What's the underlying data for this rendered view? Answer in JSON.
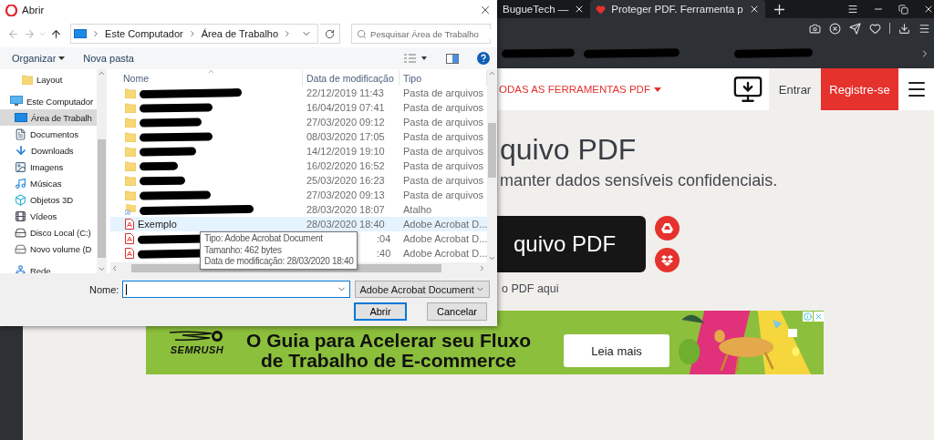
{
  "browser": {
    "tabs": [
      {
        "title": "BugueTech —",
        "selected": false
      },
      {
        "title": "Proteger PDF. Ferramenta p",
        "selected": true
      }
    ],
    "page": {
      "nav_link": "ODAS AS FERRAMENTAS PDF",
      "login": "Entrar",
      "signup": "Registre-se",
      "heading": "quivo PDF",
      "subtitle": "manter dados sensíveis confidenciais.",
      "upload_button": "quivo PDF",
      "drop_hint": "o PDF aqui",
      "ad": {
        "brand": "SEMRUSH",
        "headline": [
          "O Guia para Acelerar seu Fluxo",
          "de Trabalho de E-commerce"
        ],
        "button": "Leia mais"
      }
    }
  },
  "dialog": {
    "title": "Abrir",
    "breadcrumb": [
      "Este Computador",
      "Área de Trabalho"
    ],
    "search": {
      "placeholder": "Pesquisar Área de Trabalho"
    },
    "toolbar": {
      "organize": "Organizar",
      "new_folder": "Nova pasta"
    },
    "nav": [
      {
        "kind": "folder",
        "label": "Layout",
        "selected": false
      },
      {
        "kind": "computer",
        "label": "Este Computador",
        "selected": false,
        "children": [
          {
            "kind": "desktop",
            "label": "Área de Trabalh",
            "selected": true
          },
          {
            "kind": "documents",
            "label": "Documentos",
            "selected": false
          },
          {
            "kind": "downloads",
            "label": "Downloads",
            "selected": false
          },
          {
            "kind": "images",
            "label": "Imagens",
            "selected": false
          },
          {
            "kind": "music",
            "label": "Músicas",
            "selected": false
          },
          {
            "kind": "objects",
            "label": "Objetos 3D",
            "selected": false
          },
          {
            "kind": "videos",
            "label": "Vídeos",
            "selected": false
          },
          {
            "kind": "disk",
            "label": "Disco Local (C:)",
            "selected": false
          },
          {
            "kind": "drive",
            "label": "Novo volume (D",
            "selected": false
          }
        ]
      },
      {
        "kind": "network",
        "label": "Rede",
        "selected": false
      }
    ],
    "columns": [
      "Nome",
      "Data de modificação",
      "Tipo"
    ],
    "files": [
      {
        "kind": "folder",
        "redacted": true,
        "date": "22/12/2019 11:43",
        "type": "Pasta de arquivos",
        "highlighted": false
      },
      {
        "kind": "folder",
        "redacted": true,
        "date": "16/04/2019 07:41",
        "type": "Pasta de arquivos",
        "highlighted": false
      },
      {
        "kind": "folder",
        "redacted": true,
        "date": "27/03/2020 09:12",
        "type": "Pasta de arquivos",
        "highlighted": false
      },
      {
        "kind": "folder",
        "redacted": true,
        "date": "08/03/2020 17:05",
        "type": "Pasta de arquivos",
        "highlighted": false
      },
      {
        "kind": "folder",
        "redacted": true,
        "date": "14/12/2019 19:10",
        "type": "Pasta de arquivos",
        "highlighted": false
      },
      {
        "kind": "folder",
        "redacted": true,
        "date": "16/02/2020 16:52",
        "type": "Pasta de arquivos",
        "highlighted": false
      },
      {
        "kind": "folder",
        "redacted": true,
        "date": "25/03/2020 16:23",
        "type": "Pasta de arquivos",
        "highlighted": false
      },
      {
        "kind": "folder",
        "redacted": true,
        "date": "27/03/2020 09:13",
        "type": "Pasta de arquivos",
        "highlighted": false
      },
      {
        "kind": "shortcut",
        "redacted": true,
        "date": "28/03/2020 18:07",
        "type": "Atalho",
        "highlighted": false
      },
      {
        "kind": "pdf",
        "redacted": false,
        "name": "Exemplo",
        "date": "28/03/2020 18:40",
        "type": "Adobe Acrobat D...",
        "highlighted": true
      },
      {
        "kind": "pdf",
        "redacted": true,
        "date": ":04",
        "type": "Adobe Acrobat D...",
        "highlighted": false,
        "under_tooltip": true
      },
      {
        "kind": "pdf",
        "redacted": true,
        "date": ":40",
        "type": "Adobe Acrobat D...",
        "highlighted": false,
        "under_tooltip": true
      }
    ],
    "tooltip": [
      "Tipo: Adobe Acrobat Document",
      "Tamanho: 462 bytes",
      "Data de modificação: 28/03/2020 18:40"
    ],
    "filename_label": "Nome:",
    "file_type": "Adobe Acrobat Document",
    "buttons": [
      {
        "label": "Abrir",
        "default": true
      },
      {
        "label": "Cancelar",
        "default": false
      }
    ]
  }
}
